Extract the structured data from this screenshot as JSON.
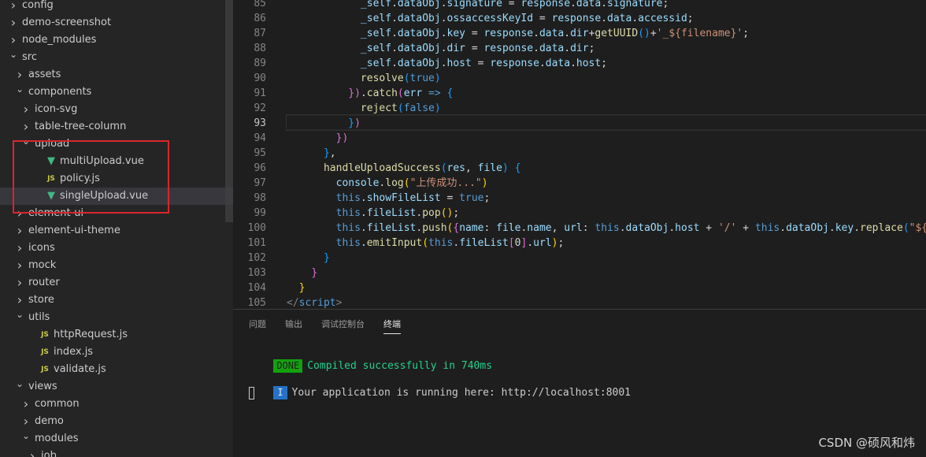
{
  "explorer": {
    "items": [
      {
        "label": "config",
        "depth": 0,
        "kind": "folder",
        "open": false
      },
      {
        "label": "demo-screenshot",
        "depth": 0,
        "kind": "folder",
        "open": false
      },
      {
        "label": "node_modules",
        "depth": 0,
        "kind": "folder",
        "open": false
      },
      {
        "label": "src",
        "depth": 0,
        "kind": "folder",
        "open": true
      },
      {
        "label": "assets",
        "depth": 1,
        "kind": "folder",
        "open": false
      },
      {
        "label": "components",
        "depth": 1,
        "kind": "folder",
        "open": true
      },
      {
        "label": "icon-svg",
        "depth": 2,
        "kind": "folder",
        "open": false
      },
      {
        "label": "table-tree-column",
        "depth": 2,
        "kind": "folder",
        "open": false
      },
      {
        "label": "upload",
        "depth": 2,
        "kind": "folder",
        "open": true
      },
      {
        "label": "multiUpload.vue",
        "depth": 3,
        "kind": "vue"
      },
      {
        "label": "policy.js",
        "depth": 3,
        "kind": "js"
      },
      {
        "label": "singleUpload.vue",
        "depth": 3,
        "kind": "vue",
        "selected": true
      },
      {
        "label": "element-ui",
        "depth": 1,
        "kind": "folder",
        "open": false
      },
      {
        "label": "element-ui-theme",
        "depth": 1,
        "kind": "folder",
        "open": false
      },
      {
        "label": "icons",
        "depth": 1,
        "kind": "folder",
        "open": false
      },
      {
        "label": "mock",
        "depth": 1,
        "kind": "folder",
        "open": false
      },
      {
        "label": "router",
        "depth": 1,
        "kind": "folder",
        "open": false
      },
      {
        "label": "store",
        "depth": 1,
        "kind": "folder",
        "open": false
      },
      {
        "label": "utils",
        "depth": 1,
        "kind": "folder",
        "open": true
      },
      {
        "label": "httpRequest.js",
        "depth": 2,
        "kind": "js"
      },
      {
        "label": "index.js",
        "depth": 2,
        "kind": "js"
      },
      {
        "label": "validate.js",
        "depth": 2,
        "kind": "js"
      },
      {
        "label": "views",
        "depth": 1,
        "kind": "folder",
        "open": true
      },
      {
        "label": "common",
        "depth": 2,
        "kind": "folder",
        "open": false
      },
      {
        "label": "demo",
        "depth": 2,
        "kind": "folder",
        "open": false
      },
      {
        "label": "modules",
        "depth": 2,
        "kind": "folder",
        "open": true
      },
      {
        "label": "job",
        "depth": 3,
        "kind": "folder",
        "open": false
      }
    ]
  },
  "editor": {
    "active_line": "93",
    "lines": [
      {
        "n": "85",
        "tokens": [
          [
            "            ",
            "t-tx"
          ],
          [
            "_self",
            "t-var"
          ],
          [
            ".",
            "t-tx"
          ],
          [
            "dataObj",
            "t-var"
          ],
          [
            ".",
            "t-tx"
          ],
          [
            "signature",
            "t-var"
          ],
          [
            " = ",
            "t-tx"
          ],
          [
            "response",
            "t-var"
          ],
          [
            ".",
            "t-tx"
          ],
          [
            "data",
            "t-var"
          ],
          [
            ".",
            "t-tx"
          ],
          [
            "signature",
            "t-var"
          ],
          [
            ";",
            "t-tx"
          ]
        ]
      },
      {
        "n": "86",
        "tokens": [
          [
            "            ",
            "t-tx"
          ],
          [
            "_self",
            "t-var"
          ],
          [
            ".",
            "t-tx"
          ],
          [
            "dataObj",
            "t-var"
          ],
          [
            ".",
            "t-tx"
          ],
          [
            "ossaccessKeyId",
            "t-var"
          ],
          [
            " = ",
            "t-tx"
          ],
          [
            "response",
            "t-var"
          ],
          [
            ".",
            "t-tx"
          ],
          [
            "data",
            "t-var"
          ],
          [
            ".",
            "t-tx"
          ],
          [
            "accessid",
            "t-var"
          ],
          [
            ";",
            "t-tx"
          ]
        ]
      },
      {
        "n": "87",
        "tokens": [
          [
            "            ",
            "t-tx"
          ],
          [
            "_self",
            "t-var"
          ],
          [
            ".",
            "t-tx"
          ],
          [
            "dataObj",
            "t-var"
          ],
          [
            ".",
            "t-tx"
          ],
          [
            "key",
            "t-var"
          ],
          [
            " = ",
            "t-tx"
          ],
          [
            "response",
            "t-var"
          ],
          [
            ".",
            "t-tx"
          ],
          [
            "data",
            "t-var"
          ],
          [
            ".",
            "t-tx"
          ],
          [
            "dir",
            "t-var"
          ],
          [
            "+",
            "t-tx"
          ],
          [
            "getUUID",
            "t-fn"
          ],
          [
            "()",
            "t-br3"
          ],
          [
            "+",
            "t-tx"
          ],
          [
            "'_${filename}'",
            "t-str"
          ],
          [
            ";",
            "t-tx"
          ]
        ]
      },
      {
        "n": "88",
        "tokens": [
          [
            "            ",
            "t-tx"
          ],
          [
            "_self",
            "t-var"
          ],
          [
            ".",
            "t-tx"
          ],
          [
            "dataObj",
            "t-var"
          ],
          [
            ".",
            "t-tx"
          ],
          [
            "dir",
            "t-var"
          ],
          [
            " = ",
            "t-tx"
          ],
          [
            "response",
            "t-var"
          ],
          [
            ".",
            "t-tx"
          ],
          [
            "data",
            "t-var"
          ],
          [
            ".",
            "t-tx"
          ],
          [
            "dir",
            "t-var"
          ],
          [
            ";",
            "t-tx"
          ]
        ]
      },
      {
        "n": "89",
        "tokens": [
          [
            "            ",
            "t-tx"
          ],
          [
            "_self",
            "t-var"
          ],
          [
            ".",
            "t-tx"
          ],
          [
            "dataObj",
            "t-var"
          ],
          [
            ".",
            "t-tx"
          ],
          [
            "host",
            "t-var"
          ],
          [
            " = ",
            "t-tx"
          ],
          [
            "response",
            "t-var"
          ],
          [
            ".",
            "t-tx"
          ],
          [
            "data",
            "t-var"
          ],
          [
            ".",
            "t-tx"
          ],
          [
            "host",
            "t-var"
          ],
          [
            ";",
            "t-tx"
          ]
        ]
      },
      {
        "n": "90",
        "tokens": [
          [
            "            ",
            "t-tx"
          ],
          [
            "resolve",
            "t-fn"
          ],
          [
            "(",
            "t-br3"
          ],
          [
            "true",
            "t-kw"
          ],
          [
            ")",
            "t-br3"
          ]
        ]
      },
      {
        "n": "91",
        "tokens": [
          [
            "          ",
            "t-tx"
          ],
          [
            "})",
            "t-br2"
          ],
          [
            ".",
            "t-tx"
          ],
          [
            "catch",
            "t-fn"
          ],
          [
            "(",
            "t-br2"
          ],
          [
            "err",
            "t-var"
          ],
          [
            " ",
            "t-tx"
          ],
          [
            "=>",
            "t-kw"
          ],
          [
            " ",
            "t-tx"
          ],
          [
            "{",
            "t-br3"
          ]
        ]
      },
      {
        "n": "92",
        "tokens": [
          [
            "            ",
            "t-tx"
          ],
          [
            "reject",
            "t-fn"
          ],
          [
            "(",
            "t-br3"
          ],
          [
            "false",
            "t-kw"
          ],
          [
            ")",
            "t-br3"
          ]
        ]
      },
      {
        "n": "93",
        "tokens": [
          [
            "          ",
            "t-tx"
          ],
          [
            "}",
            "t-br3"
          ],
          [
            ")",
            "t-br2"
          ]
        ]
      },
      {
        "n": "94",
        "tokens": [
          [
            "        ",
            "t-tx"
          ],
          [
            "})",
            "t-br2"
          ]
        ]
      },
      {
        "n": "95",
        "tokens": [
          [
            "      ",
            "t-tx"
          ],
          [
            "}",
            "t-br3"
          ],
          [
            ",",
            "t-tx"
          ]
        ]
      },
      {
        "n": "96",
        "tokens": [
          [
            "      ",
            "t-tx"
          ],
          [
            "handleUploadSuccess",
            "t-fn"
          ],
          [
            "(",
            "t-br3"
          ],
          [
            "res",
            "t-var"
          ],
          [
            ", ",
            "t-tx"
          ],
          [
            "file",
            "t-var"
          ],
          [
            ")",
            "t-br3"
          ],
          [
            " ",
            "t-tx"
          ],
          [
            "{",
            "t-br3"
          ]
        ]
      },
      {
        "n": "97",
        "tokens": [
          [
            "        ",
            "t-tx"
          ],
          [
            "console",
            "t-var"
          ],
          [
            ".",
            "t-tx"
          ],
          [
            "log",
            "t-fn"
          ],
          [
            "(",
            "t-br1"
          ],
          [
            "\"上传成功...\"",
            "t-str"
          ],
          [
            ")",
            "t-br1"
          ]
        ]
      },
      {
        "n": "98",
        "tokens": [
          [
            "        ",
            "t-tx"
          ],
          [
            "this",
            "t-kw"
          ],
          [
            ".",
            "t-tx"
          ],
          [
            "showFileList",
            "t-var"
          ],
          [
            " = ",
            "t-tx"
          ],
          [
            "true",
            "t-kw"
          ],
          [
            ";",
            "t-tx"
          ]
        ]
      },
      {
        "n": "99",
        "tokens": [
          [
            "        ",
            "t-tx"
          ],
          [
            "this",
            "t-kw"
          ],
          [
            ".",
            "t-tx"
          ],
          [
            "fileList",
            "t-var"
          ],
          [
            ".",
            "t-tx"
          ],
          [
            "pop",
            "t-fn"
          ],
          [
            "()",
            "t-br1"
          ],
          [
            ";",
            "t-tx"
          ]
        ]
      },
      {
        "n": "100",
        "tokens": [
          [
            "        ",
            "t-tx"
          ],
          [
            "this",
            "t-kw"
          ],
          [
            ".",
            "t-tx"
          ],
          [
            "fileList",
            "t-var"
          ],
          [
            ".",
            "t-tx"
          ],
          [
            "push",
            "t-fn"
          ],
          [
            "(",
            "t-br1"
          ],
          [
            "{",
            "t-br2"
          ],
          [
            "name",
            "t-var"
          ],
          [
            ": ",
            "t-tx"
          ],
          [
            "file",
            "t-var"
          ],
          [
            ".",
            "t-tx"
          ],
          [
            "name",
            "t-var"
          ],
          [
            ", ",
            "t-tx"
          ],
          [
            "url",
            "t-var"
          ],
          [
            ": ",
            "t-tx"
          ],
          [
            "this",
            "t-kw"
          ],
          [
            ".",
            "t-tx"
          ],
          [
            "dataObj",
            "t-var"
          ],
          [
            ".",
            "t-tx"
          ],
          [
            "host",
            "t-var"
          ],
          [
            " + ",
            "t-tx"
          ],
          [
            "'/'",
            "t-str"
          ],
          [
            " + ",
            "t-tx"
          ],
          [
            "this",
            "t-kw"
          ],
          [
            ".",
            "t-tx"
          ],
          [
            "dataObj",
            "t-var"
          ],
          [
            ".",
            "t-tx"
          ],
          [
            "key",
            "t-var"
          ],
          [
            ".",
            "t-tx"
          ],
          [
            "replace",
            "t-fn"
          ],
          [
            "(",
            "t-br3"
          ],
          [
            "\"${fi",
            "t-str"
          ]
        ]
      },
      {
        "n": "101",
        "tokens": [
          [
            "        ",
            "t-tx"
          ],
          [
            "this",
            "t-kw"
          ],
          [
            ".",
            "t-tx"
          ],
          [
            "emitInput",
            "t-fn"
          ],
          [
            "(",
            "t-br1"
          ],
          [
            "this",
            "t-kw"
          ],
          [
            ".",
            "t-tx"
          ],
          [
            "fileList",
            "t-var"
          ],
          [
            "[",
            "t-br2"
          ],
          [
            "0",
            "t-tx"
          ],
          [
            "]",
            "t-br2"
          ],
          [
            ".",
            "t-tx"
          ],
          [
            "url",
            "t-var"
          ],
          [
            ")",
            "t-br1"
          ],
          [
            ";",
            "t-tx"
          ]
        ]
      },
      {
        "n": "102",
        "tokens": [
          [
            "      ",
            "t-tx"
          ],
          [
            "}",
            "t-br3"
          ]
        ]
      },
      {
        "n": "103",
        "tokens": [
          [
            "    ",
            "t-tx"
          ],
          [
            "}",
            "t-br2"
          ]
        ]
      },
      {
        "n": "104",
        "tokens": [
          [
            "  ",
            "t-tx"
          ],
          [
            "}",
            "t-br1"
          ]
        ]
      },
      {
        "n": "105",
        "tokens": [
          [
            "</",
            "t-tag"
          ],
          [
            "script",
            "t-tgn"
          ],
          [
            ">",
            "t-tag"
          ]
        ]
      }
    ]
  },
  "panel": {
    "tabs": [
      {
        "label": "问题",
        "active": false
      },
      {
        "label": "输出",
        "active": false
      },
      {
        "label": "调试控制台",
        "active": false
      },
      {
        "label": "终端",
        "active": true
      }
    ],
    "terminal": {
      "done_badge": "DONE",
      "done_text": "Compiled successfully in 740ms",
      "info_badge": "I",
      "running_text": "Your application is running here: http://localhost:8001"
    }
  },
  "watermark": "CSDN @硕风和炜"
}
